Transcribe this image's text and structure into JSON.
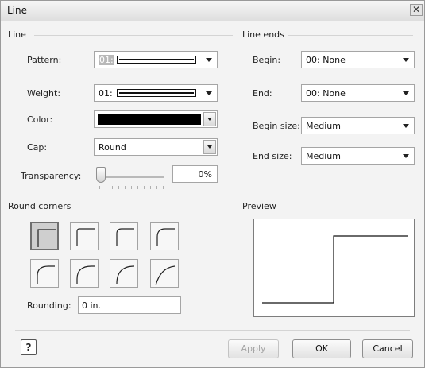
{
  "dialog": {
    "title": "Line",
    "close_glyph": "✕"
  },
  "line_group": {
    "label": "Line",
    "pattern_label": "Pattern:",
    "pattern_value": "01:",
    "weight_label": "Weight:",
    "weight_value": "01:",
    "color_label": "Color:",
    "color_value": "#000000",
    "cap_label": "Cap:",
    "cap_value": "Round",
    "transparency_label": "Transparency:",
    "transparency_value": "0%"
  },
  "line_ends": {
    "label": "Line ends",
    "begin_label": "Begin:",
    "begin_value": "00: None",
    "end_label": "End:",
    "end_value": "00: None",
    "begin_size_label": "Begin size:",
    "begin_size_value": "Medium",
    "end_size_label": "End size:",
    "end_size_value": "Medium"
  },
  "round_corners": {
    "label": "Round corners",
    "selected_index": 0,
    "rounding_label": "Rounding:",
    "rounding_value": "0 in."
  },
  "preview": {
    "label": "Preview"
  },
  "buttons": {
    "help": "?",
    "apply": "Apply",
    "ok": "OK",
    "cancel": "Cancel"
  }
}
